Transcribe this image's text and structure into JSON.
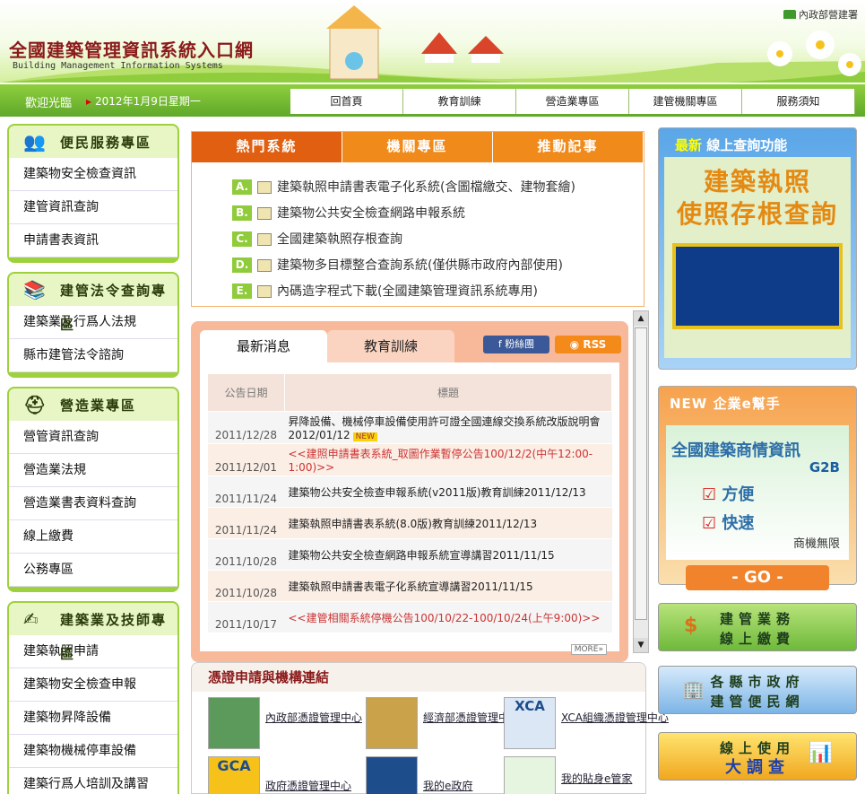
{
  "header": {
    "title": "全國建築管理資訊系統入口網",
    "subtitle": "Building Management Information Systems",
    "ministry": "內政部營建署"
  },
  "nav": {
    "welcome": "歡迎光臨",
    "date": "2012年1月9日星期一",
    "tabs": [
      "回首頁",
      "教育訓練",
      "營造業專區",
      "建管機關專區",
      "服務須知"
    ]
  },
  "sidebar": {
    "boxes": [
      {
        "title": "便民服務專區",
        "icon": "people-icon",
        "items": [
          "建築物安全檢查資訊",
          "建管資訊查詢",
          "申請書表資訊"
        ]
      },
      {
        "title": "建管法令查詢專區",
        "icon": "books-icon",
        "items": [
          "建築業及行爲人法規",
          "縣市建管法令諮詢"
        ]
      },
      {
        "title": "營造業專區",
        "icon": "hardhat-icon",
        "items": [
          "營管資訊查詢",
          "營造業法規",
          "營造業書表資料查詢",
          "線上繳費",
          "公務專區"
        ]
      },
      {
        "title": "建築業及技師專區",
        "icon": "pen-icon",
        "items": [
          "建築執照申請",
          "建築物安全檢查申報",
          "建築物昇降設備",
          "建築物機械停車設備",
          "建築行爲人培訓及講習"
        ]
      }
    ]
  },
  "hot": {
    "tabs": [
      "熱門系統",
      "機關專區",
      "推動記事"
    ],
    "items": [
      {
        "badge": "A.",
        "label": "建築執照申請書表電子化系統(含圖檔繳交、建物套繪)"
      },
      {
        "badge": "B.",
        "label": "建築物公共安全檢查網路申報系統"
      },
      {
        "badge": "C.",
        "label": "全國建築執照存根查詢"
      },
      {
        "badge": "D.",
        "label": "建築物多目標整合查詢系統(僅供縣市政府內部使用)"
      },
      {
        "badge": "E.",
        "label": "內碼造字程式下載(全國建築管理資訊系統專用)"
      }
    ]
  },
  "news": {
    "tabs": [
      "最新消息",
      "教育訓練"
    ],
    "facebook": "粉絲團",
    "rss": "RSS",
    "col_date": "公告日期",
    "col_title": "標題",
    "more": "MORE»",
    "new_tag": "NEW",
    "rows": [
      {
        "date": "2011/12/28",
        "title": "昇降設備、機械停車設備使用許可證全國連線交換系統改版說明會2012/01/12",
        "highlight": false,
        "new": true
      },
      {
        "date": "2011/12/01",
        "title": "<<建照申請書表系統_取圖作業暫停公告100/12/2(中午12:00-1:00)>>",
        "highlight": true,
        "new": false
      },
      {
        "date": "2011/11/24",
        "title": "建築物公共安全檢查申報系統(v2011版)教育訓練2011/12/13",
        "highlight": false,
        "new": false
      },
      {
        "date": "2011/11/24",
        "title": "建築執照申請書表系統(8.0版)教育訓練2011/12/13",
        "highlight": false,
        "new": false
      },
      {
        "date": "2011/10/28",
        "title": "建築物公共安全檢查網路申報系統宣導講習2011/11/15",
        "highlight": false,
        "new": false
      },
      {
        "date": "2011/10/28",
        "title": "建築執照申請書表電子化系統宣導講習2011/11/15",
        "highlight": false,
        "new": false
      },
      {
        "date": "2011/10/17",
        "title": "<<建管相關系統停機公告100/10/22-100/10/24(上午9:00)>>",
        "highlight": true,
        "new": false
      }
    ]
  },
  "cert": {
    "title": "憑證申請與機構連結",
    "items": [
      "內政部憑證管理中心",
      "經濟部憑證管理中心",
      "XCA組織憑證管理中心",
      "政府憑證管理中心",
      "我的e政府",
      "我的貼身e管家"
    ],
    "img_labels": [
      "XCA",
      "GCA"
    ]
  },
  "right": {
    "box1_h1": "最新",
    "box1_h2": "線上查詢功能",
    "box1_l1": "建築執照",
    "box1_l2": "使照存根查詢",
    "box2_h": "NEW 企業e幫手",
    "box2_t1": "全國建築商情資訊",
    "box2_g2b": "G2B",
    "box2_c1": "方便",
    "box2_c2": "快速",
    "box2_t4": "商機無限",
    "box2_go": "- GO -",
    "btn1_l1": "建管業務",
    "btn1_l2": "線上繳費",
    "btn2_l1": "各縣市政府",
    "btn2_l2": "建管便民網",
    "btn3_l1": "線上使用",
    "btn3_l2": "大調查"
  }
}
